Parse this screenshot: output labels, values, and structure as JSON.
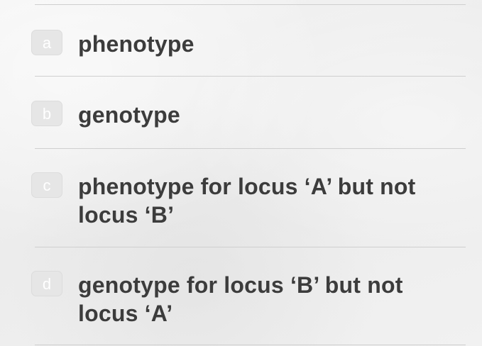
{
  "options": [
    {
      "letter": "a",
      "text": "phenotype"
    },
    {
      "letter": "b",
      "text": "genotype"
    },
    {
      "letter": "c",
      "text": "phenotype for locus ‘A’ but not locus ‘B’"
    },
    {
      "letter": "d",
      "text": "genotype for locus ‘B’ but not locus ‘A’"
    }
  ]
}
